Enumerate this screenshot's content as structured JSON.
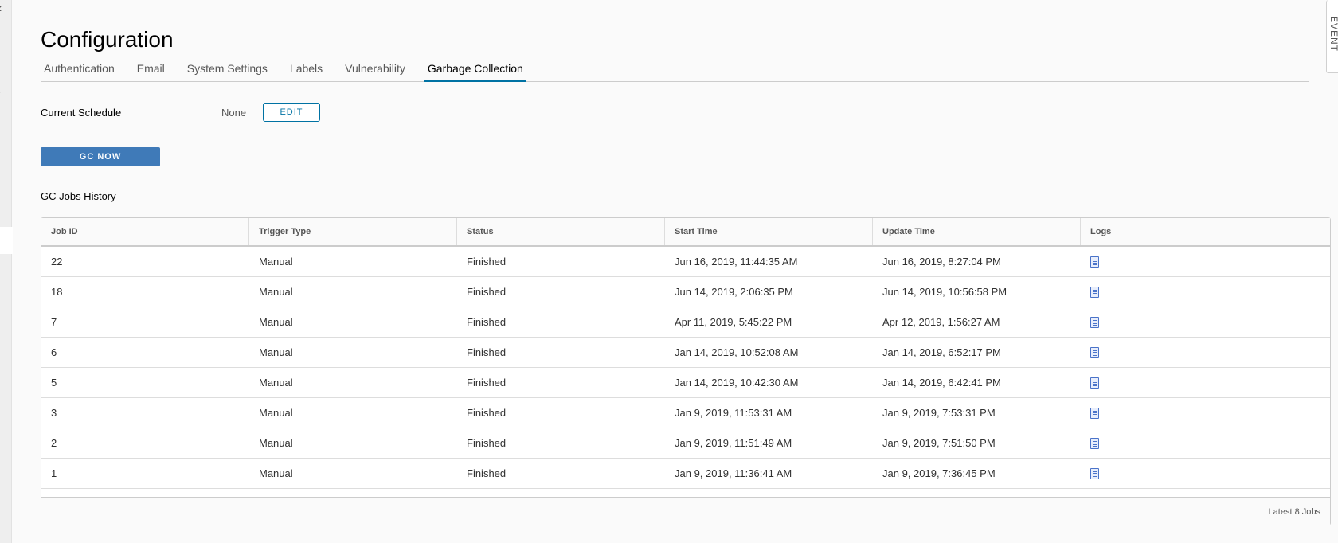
{
  "page": {
    "title": "Configuration"
  },
  "sidebar": {
    "collapse_glyph": "‹",
    "side_glyph": "›"
  },
  "events_panel": {
    "label": "EVENT"
  },
  "tabs": [
    {
      "label": "Authentication"
    },
    {
      "label": "Email"
    },
    {
      "label": "System Settings"
    },
    {
      "label": "Labels"
    },
    {
      "label": "Vulnerability"
    },
    {
      "label": "Garbage Collection",
      "active": true
    }
  ],
  "schedule": {
    "label": "Current Schedule",
    "value": "None",
    "edit_label": "EDIT"
  },
  "gc_now_label": "GC NOW",
  "history": {
    "title": "GC Jobs History",
    "columns": [
      "Job ID",
      "Trigger Type",
      "Status",
      "Start Time",
      "Update Time",
      "Logs"
    ],
    "rows": [
      {
        "id": "22",
        "trigger": "Manual",
        "status": "Finished",
        "start": "Jun 16, 2019, 11:44:35 AM",
        "update": "Jun 16, 2019, 8:27:04 PM"
      },
      {
        "id": "18",
        "trigger": "Manual",
        "status": "Finished",
        "start": "Jun 14, 2019, 2:06:35 PM",
        "update": "Jun 14, 2019, 10:56:58 PM"
      },
      {
        "id": "7",
        "trigger": "Manual",
        "status": "Finished",
        "start": "Apr 11, 2019, 5:45:22 PM",
        "update": "Apr 12, 2019, 1:56:27 AM"
      },
      {
        "id": "6",
        "trigger": "Manual",
        "status": "Finished",
        "start": "Jan 14, 2019, 10:52:08 AM",
        "update": "Jan 14, 2019, 6:52:17 PM"
      },
      {
        "id": "5",
        "trigger": "Manual",
        "status": "Finished",
        "start": "Jan 14, 2019, 10:42:30 AM",
        "update": "Jan 14, 2019, 6:42:41 PM"
      },
      {
        "id": "3",
        "trigger": "Manual",
        "status": "Finished",
        "start": "Jan 9, 2019, 11:53:31 AM",
        "update": "Jan 9, 2019, 7:53:31 PM"
      },
      {
        "id": "2",
        "trigger": "Manual",
        "status": "Finished",
        "start": "Jan 9, 2019, 11:51:49 AM",
        "update": "Jan 9, 2019, 7:51:50 PM"
      },
      {
        "id": "1",
        "trigger": "Manual",
        "status": "Finished",
        "start": "Jan 9, 2019, 11:36:41 AM",
        "update": "Jan 9, 2019, 7:36:45 PM"
      }
    ],
    "log_icon": "log-file-icon",
    "footer": "Latest 8 Jobs"
  },
  "colors": {
    "accent": "#0072a3",
    "primary_button": "#3f7ab8",
    "log_icon": "#4a73c9"
  }
}
